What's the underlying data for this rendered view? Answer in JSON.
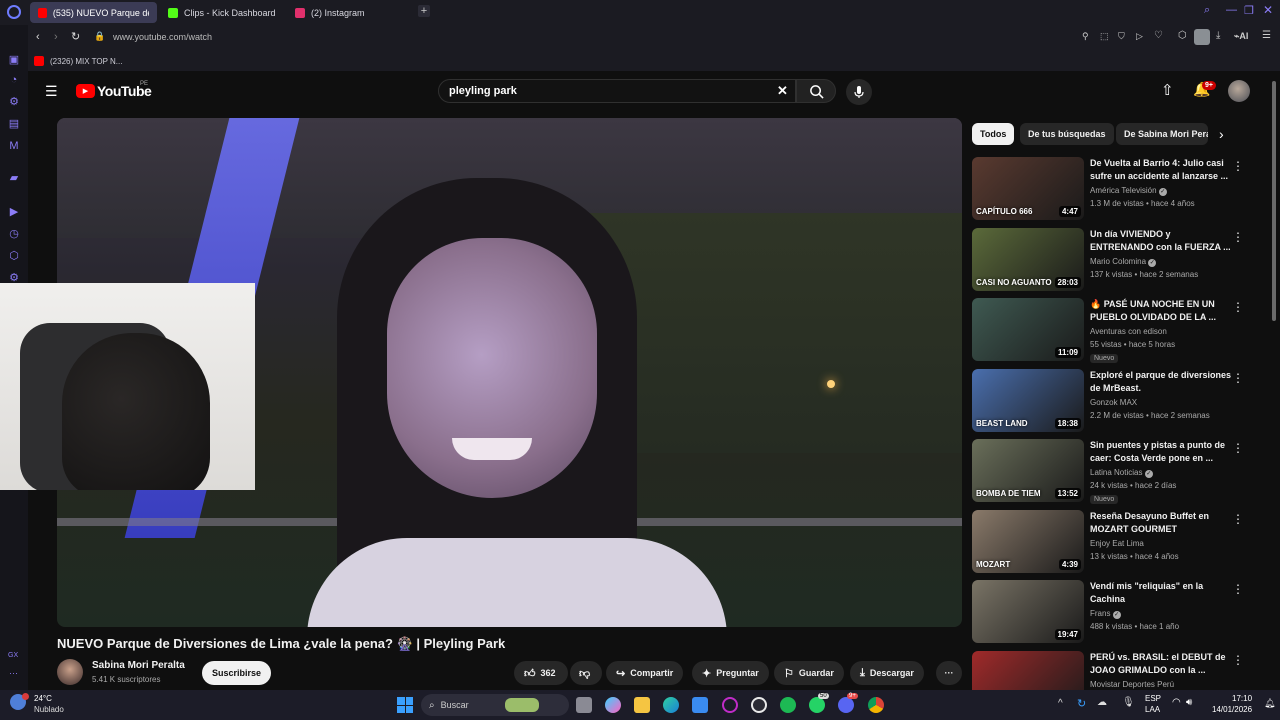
{
  "browser": {
    "tabs": [
      {
        "label": "(535) NUEVO Parque de D",
        "color": "#ff0000"
      },
      {
        "label": "Clips - Kick Dashboard",
        "color": "#53fc18"
      },
      {
        "label": "(2) Instagram",
        "color": "#e1306c"
      }
    ],
    "url": "www.youtube.com/watch",
    "bookmark": "(2326) MIX TOP N..."
  },
  "gx_label": "GX",
  "youtube": {
    "logo_text": "YouTube",
    "region": "PE",
    "search_value": "pleyling park",
    "notification_count": "9+",
    "video_title": "NUEVO Parque de Diversiones de Lima ¿vale la pena? 🎡 | Pleyling Park",
    "channel_name": "Sabina Mori Peralta",
    "subscribers": "5.41 K suscriptores",
    "subscribe_label": "Suscribirse",
    "likes": "362",
    "share_label": "Compartir",
    "ask_label": "Preguntar",
    "save_label": "Guardar",
    "download_label": "Descargar",
    "chips": [
      "Todos",
      "De tus búsquedas",
      "De Sabina Mori Pera"
    ],
    "recommendations": [
      {
        "title": "De Vuelta al Barrio 4: Julio casi sufre un accidente al lanzarse ...",
        "channel": "América Televisión",
        "verified": true,
        "meta": "1.3 M de vistas • hace 4 años",
        "duration": "4:47",
        "badge": "",
        "thumb_text": "CAPÍTULO 666",
        "thumb_color": "#5a3a30"
      },
      {
        "title": "Un día VIVIENDO y ENTRENANDO con la FUERZA ...",
        "channel": "Mario Colomina",
        "verified": true,
        "meta": "137 k vistas • hace 2 semanas",
        "duration": "28:03",
        "badge": "",
        "thumb_text": "CASI NO AGUANTO",
        "thumb_color": "#5b6a3a"
      },
      {
        "title": "🔥 PASÉ UNA NOCHE EN UN PUEBLO OLVIDADO DE LA ...",
        "channel": "Aventuras con edison",
        "verified": false,
        "meta": "55 vistas • hace 5 horas",
        "duration": "11:09",
        "badge": "Nuevo",
        "thumb_text": "",
        "thumb_color": "#3f5a52"
      },
      {
        "title": "Exploré el parque de diversiones de MrBeast.",
        "channel": "Gonzok MAX",
        "verified": false,
        "meta": "2.2 M de vistas • hace 2 semanas",
        "duration": "18:38",
        "badge": "",
        "thumb_text": "BEAST LAND",
        "thumb_color": "#4a6fae"
      },
      {
        "title": "Sin puentes y pistas a punto de caer: Costa Verde pone en ...",
        "channel": "Latina Noticias",
        "verified": true,
        "meta": "24 k vistas • hace 2 días",
        "duration": "13:52",
        "badge": "Nuevo",
        "thumb_text": "BOMBA DE TIEM",
        "thumb_color": "#6a6f5a"
      },
      {
        "title": "Reseña Desayuno Buffet en MOZART GOURMET",
        "channel": "Enjoy Eat Lima",
        "verified": false,
        "meta": "13 k vistas • hace 4 años",
        "duration": "4:39",
        "badge": "",
        "thumb_text": "MOZART",
        "thumb_color": "#8a7a6a"
      },
      {
        "title": "Vendí mis \"reliquias\" en la Cachina",
        "channel": "Frans",
        "verified": true,
        "meta": "488 k vistas • hace 1 año",
        "duration": "19:47",
        "badge": "",
        "thumb_text": "",
        "thumb_color": "#7a7466"
      },
      {
        "title": "PERÚ vs. BRASIL: el DEBUT de JOAO GRIMALDO con la ...",
        "channel": "Movistar Deportes Perú",
        "verified": false,
        "meta": "",
        "duration": "",
        "badge": "",
        "thumb_text": "",
        "thumb_color": "#a02a2a"
      }
    ]
  },
  "taskbar": {
    "temperature": "24°C",
    "weather": "Nublado",
    "search_placeholder": "Buscar",
    "lang": "ESP",
    "lang2": "LAA",
    "time": "17:10",
    "date": "14/01/2026",
    "whatsapp_badge": "50",
    "discord_badge": "9+"
  }
}
